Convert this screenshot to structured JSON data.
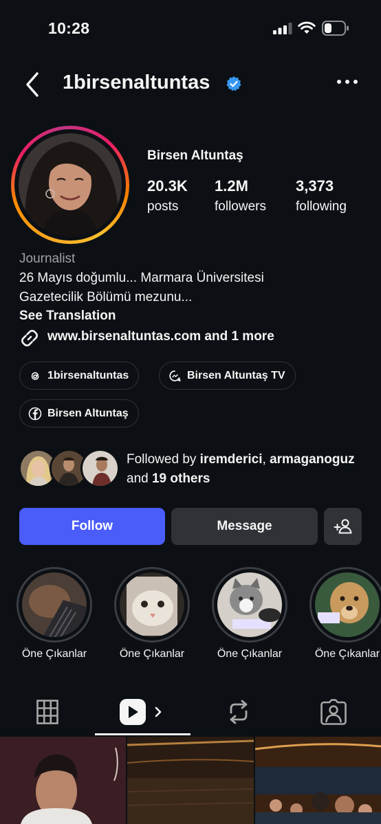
{
  "status_bar": {
    "time": "10:28"
  },
  "header": {
    "username": "1birsenaltuntas",
    "verified": true
  },
  "profile": {
    "display_name": "Birsen Altuntaş",
    "stats": {
      "posts": {
        "count": "20.3K",
        "label": "posts"
      },
      "followers": {
        "count": "1.2M",
        "label": "followers"
      },
      "following": {
        "count": "3,373",
        "label": "following"
      }
    },
    "category": "Journalist",
    "bio_line1": "26 Mayıs doğumlu... Marmara Üniversitesi",
    "bio_line2": "Gazetecilik Bölümü mezunu...",
    "see_translation": "See Translation",
    "link": "www.birsenaltuntas.com and 1 more"
  },
  "chips": {
    "threads": "1birsenaltuntas",
    "channel": "Birsen Altuntaş TV",
    "facebook": "Birsen Altuntaş"
  },
  "followed_by": {
    "prefix": "Followed by",
    "user1": "iremderici",
    "user2": "armaganoguz",
    "and": "and",
    "others": "19 others"
  },
  "actions": {
    "follow": "Follow",
    "message": "Message"
  },
  "highlights": [
    {
      "label": "Öne Çıkanlar"
    },
    {
      "label": "Öne Çıkanlar"
    },
    {
      "label": "Öne Çıkanlar"
    },
    {
      "label": "Öne Çıkanlar"
    }
  ],
  "tabs": [
    "grid-icon",
    "reels-icon",
    "reposts-icon",
    "tagged-icon"
  ],
  "colors": {
    "background": "#0c1014",
    "follow_button": "#4a5df9",
    "secondary_button": "#2f3237",
    "verified_badge": "#3897f0",
    "muted_text": "#a0a0a8"
  }
}
